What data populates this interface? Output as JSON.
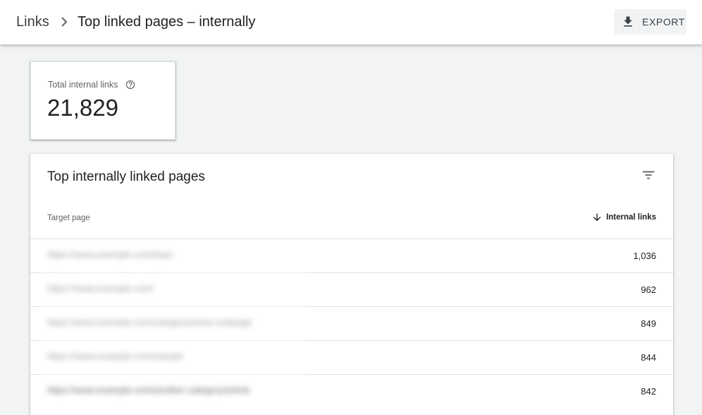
{
  "header": {
    "breadcrumb_root": "Links",
    "title": "Top linked pages – internally",
    "export_label": "EXPORT"
  },
  "summary": {
    "label": "Total internal links",
    "value": "21,829"
  },
  "table": {
    "title": "Top internally linked pages",
    "columns": {
      "target": "Target page",
      "links": "Internal links"
    },
    "rows": [
      {
        "url": "https://www.example.com/topic",
        "count": "1,036"
      },
      {
        "url": "https://www.example.com/",
        "count": "962"
      },
      {
        "url": "https://www.example.com/category/some-subpage",
        "count": "849"
      },
      {
        "url": "https://www.example.com/sample",
        "count": "844"
      },
      {
        "url": "https://www.example.com/another-category/article",
        "count": "842"
      }
    ]
  },
  "colors": {
    "background": "#f1f3f4",
    "card": "#ffffff",
    "text_primary": "#202124",
    "text_secondary": "#5f6368"
  }
}
